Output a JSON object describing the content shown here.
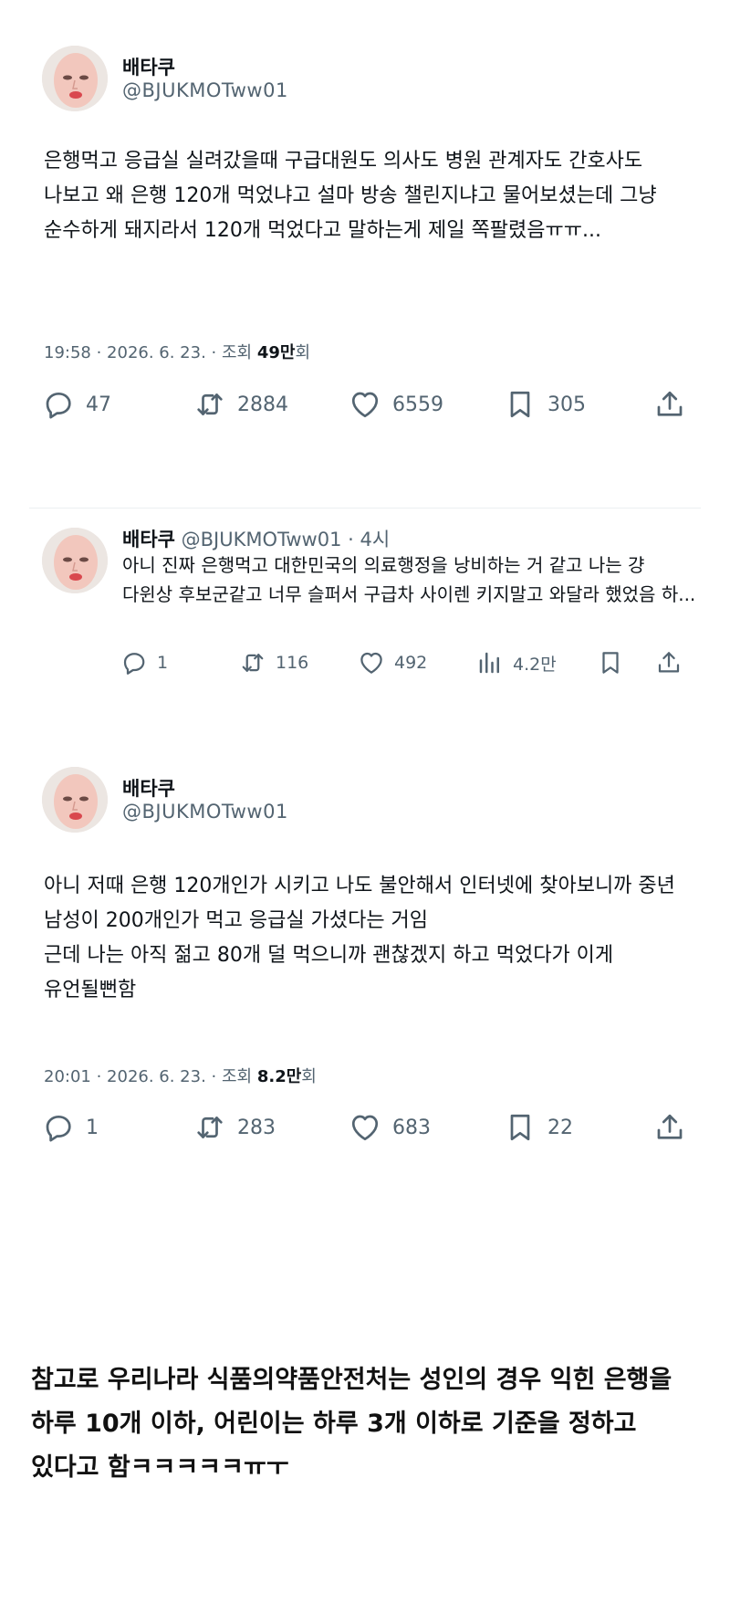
{
  "tweet1": {
    "name": "배타쿠",
    "handle": "@BJUKMOTww01",
    "text": "은행먹고 응급실 실려갔을때 구급대원도 의사도 병원 관계자도 간호사도 나보고 왜 은행 120개 먹었냐고 설마 방송 챌린지냐고 물어보셨는데 그냥 순수하게 돼지라서 120개 먹었다고 말하는게 제일 쪽팔렸음ㅠㅠ...",
    "time": "19:58 · 2026. 6. 23. · 조회 ",
    "views": "49만",
    "views_suffix": "회",
    "replies": "47",
    "retweets": "2884",
    "likes": "6559",
    "bookmarks": "305"
  },
  "reply": {
    "name": "배타쿠",
    "handle_time": " @BJUKMOTww01 · 4시",
    "text": "아니 진짜 은행먹고 대한민국의 의료행정을 낭비하는 거 같고 나는 걍 다윈상 후보군같고 너무 슬퍼서 구급차 사이렌 키지말고 와달라 했었음 하...",
    "replies": "1",
    "retweets": "116",
    "likes": "492",
    "views": "4.2만"
  },
  "tweet2": {
    "name": "배타쿠",
    "handle": "@BJUKMOTww01",
    "text": "아니 저때 은행 120개인가 시키고 나도 불안해서 인터넷에 찾아보니까 중년 남성이 200개인가 먹고 응급실 가셨다는 거임\n근데 나는 아직 젊고 80개 덜 먹으니까 괜찮겠지 하고 먹었다가 이게 유언될뻔함",
    "time": "20:01 · 2026. 6. 23. · 조회 ",
    "views": "8.2만",
    "views_suffix": "회",
    "replies": "1",
    "retweets": "283",
    "likes": "683",
    "bookmarks": "22"
  },
  "note": "참고로 우리나라 식품의약품안전처는 성인의 경우 익힌 은행을 하루 10개 이하, 어린이는 하루 3개 이하로 기준을 정하고 있다고 함ㅋㅋㅋㅋㅋㅠㅜ",
  "icons": [
    "reply-icon",
    "retweet-icon",
    "like-icon",
    "bookmark-icon",
    "share-icon",
    "views-icon"
  ],
  "colors": {
    "text": "#0f1419",
    "secondary": "#536471",
    "divider": "#eceff1"
  }
}
